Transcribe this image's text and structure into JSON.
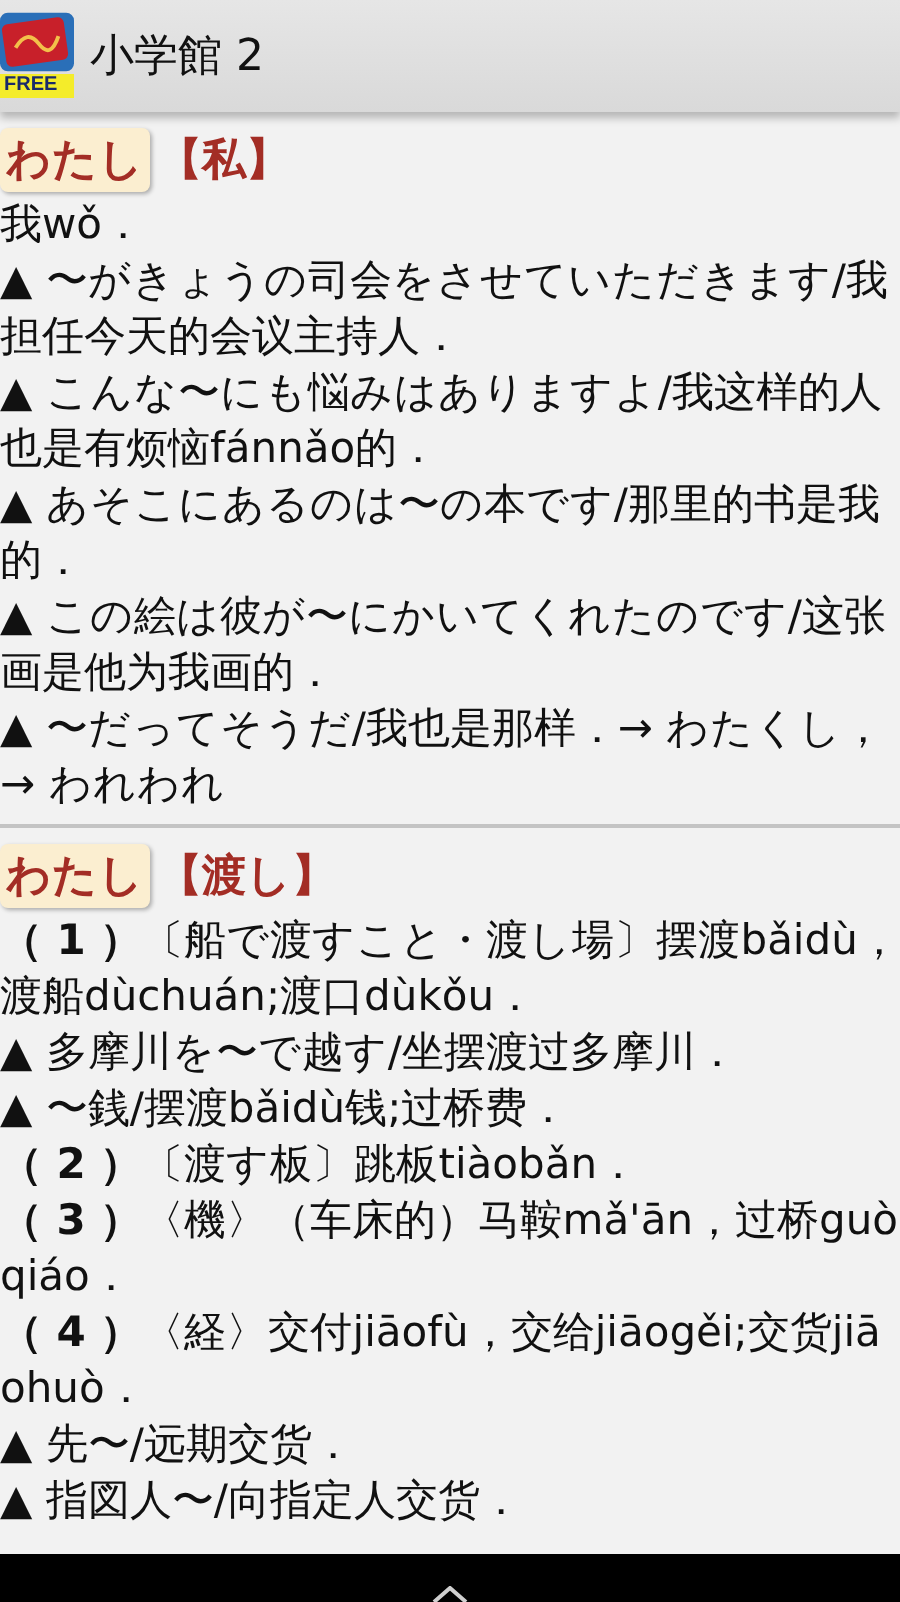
{
  "app_bar": {
    "title": "小学館 2",
    "icon_label": "FREE"
  },
  "entries": [
    {
      "reading": "わたし",
      "headword": "【私】",
      "lines": [
        "我wǒ．",
        "▲ 〜がきょうの司会をさせていただきます/我担任今天的会议主持人．",
        "▲ こんな〜にも悩みはありますよ/我这样的人也是有烦恼fánnǎo的．",
        "▲ あそこにあるのは〜の本です/那里的书是我的．",
        "▲ この絵は彼が〜にかいてくれたのです/这张画是他为我画的．",
        "▲ 〜だってそうだ/我也是那样．→ わたくし，",
        "→ われわれ"
      ]
    },
    {
      "reading": "わたし",
      "headword": "【渡し】",
      "lines": [
        "**（ 1 ）**〔船で渡すこと・渡し場〕摆渡bǎidù，渡船dùchuán;渡口dùkǒu．",
        "▲ 多摩川を〜で越す/坐摆渡过多摩川．",
        "▲ 〜銭/摆渡bǎidù钱;过桥费．",
        "**（ 2 ）**〔渡す板〕跳板tiàobǎn．",
        "**（ 3 ）**〈機〉（车床的）马鞍mǎ'ān，过桥guòqiáo．",
        "**（ 4 ）**〈経〉交付jiāofù，交给jiāogěi;交货jiāohuò．",
        "▲ 先〜/远期交货．",
        "▲ 指図人〜/向指定人交货．"
      ]
    }
  ]
}
